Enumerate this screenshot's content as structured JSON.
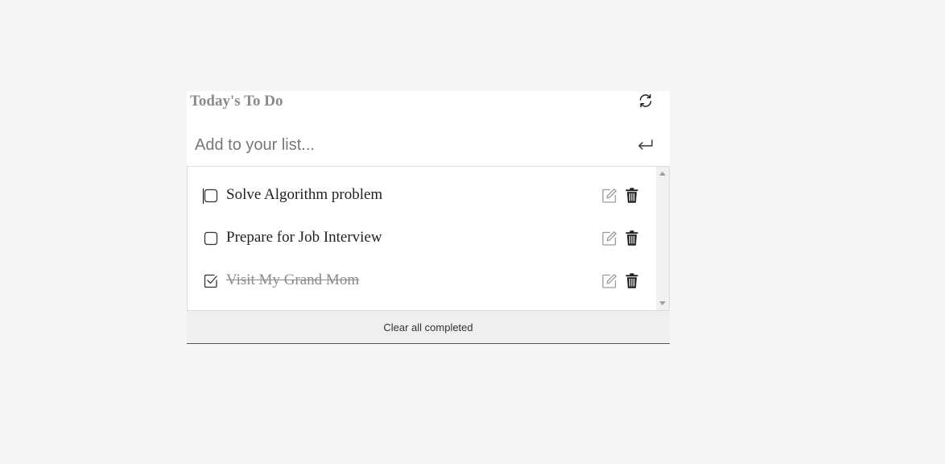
{
  "header": {
    "title": "Today's To Do",
    "refresh_icon": "refresh-icon"
  },
  "add_todo": {
    "placeholder": "Add to your list...",
    "value": "",
    "submit_icon": "enter-icon"
  },
  "todos": [
    {
      "text": "Solve Algorithm problem",
      "completed": false,
      "focused": true
    },
    {
      "text": "Prepare for Job Interview",
      "completed": false,
      "focused": false
    },
    {
      "text": "Visit My Grand Mom",
      "completed": true,
      "focused": false
    }
  ],
  "footer": {
    "clear_label": "Clear all completed"
  },
  "colors": {
    "background": "#f5f5f5",
    "title": "#8a8a8a",
    "completed_text": "#8a8a8a",
    "footer_bg": "#efefef"
  }
}
